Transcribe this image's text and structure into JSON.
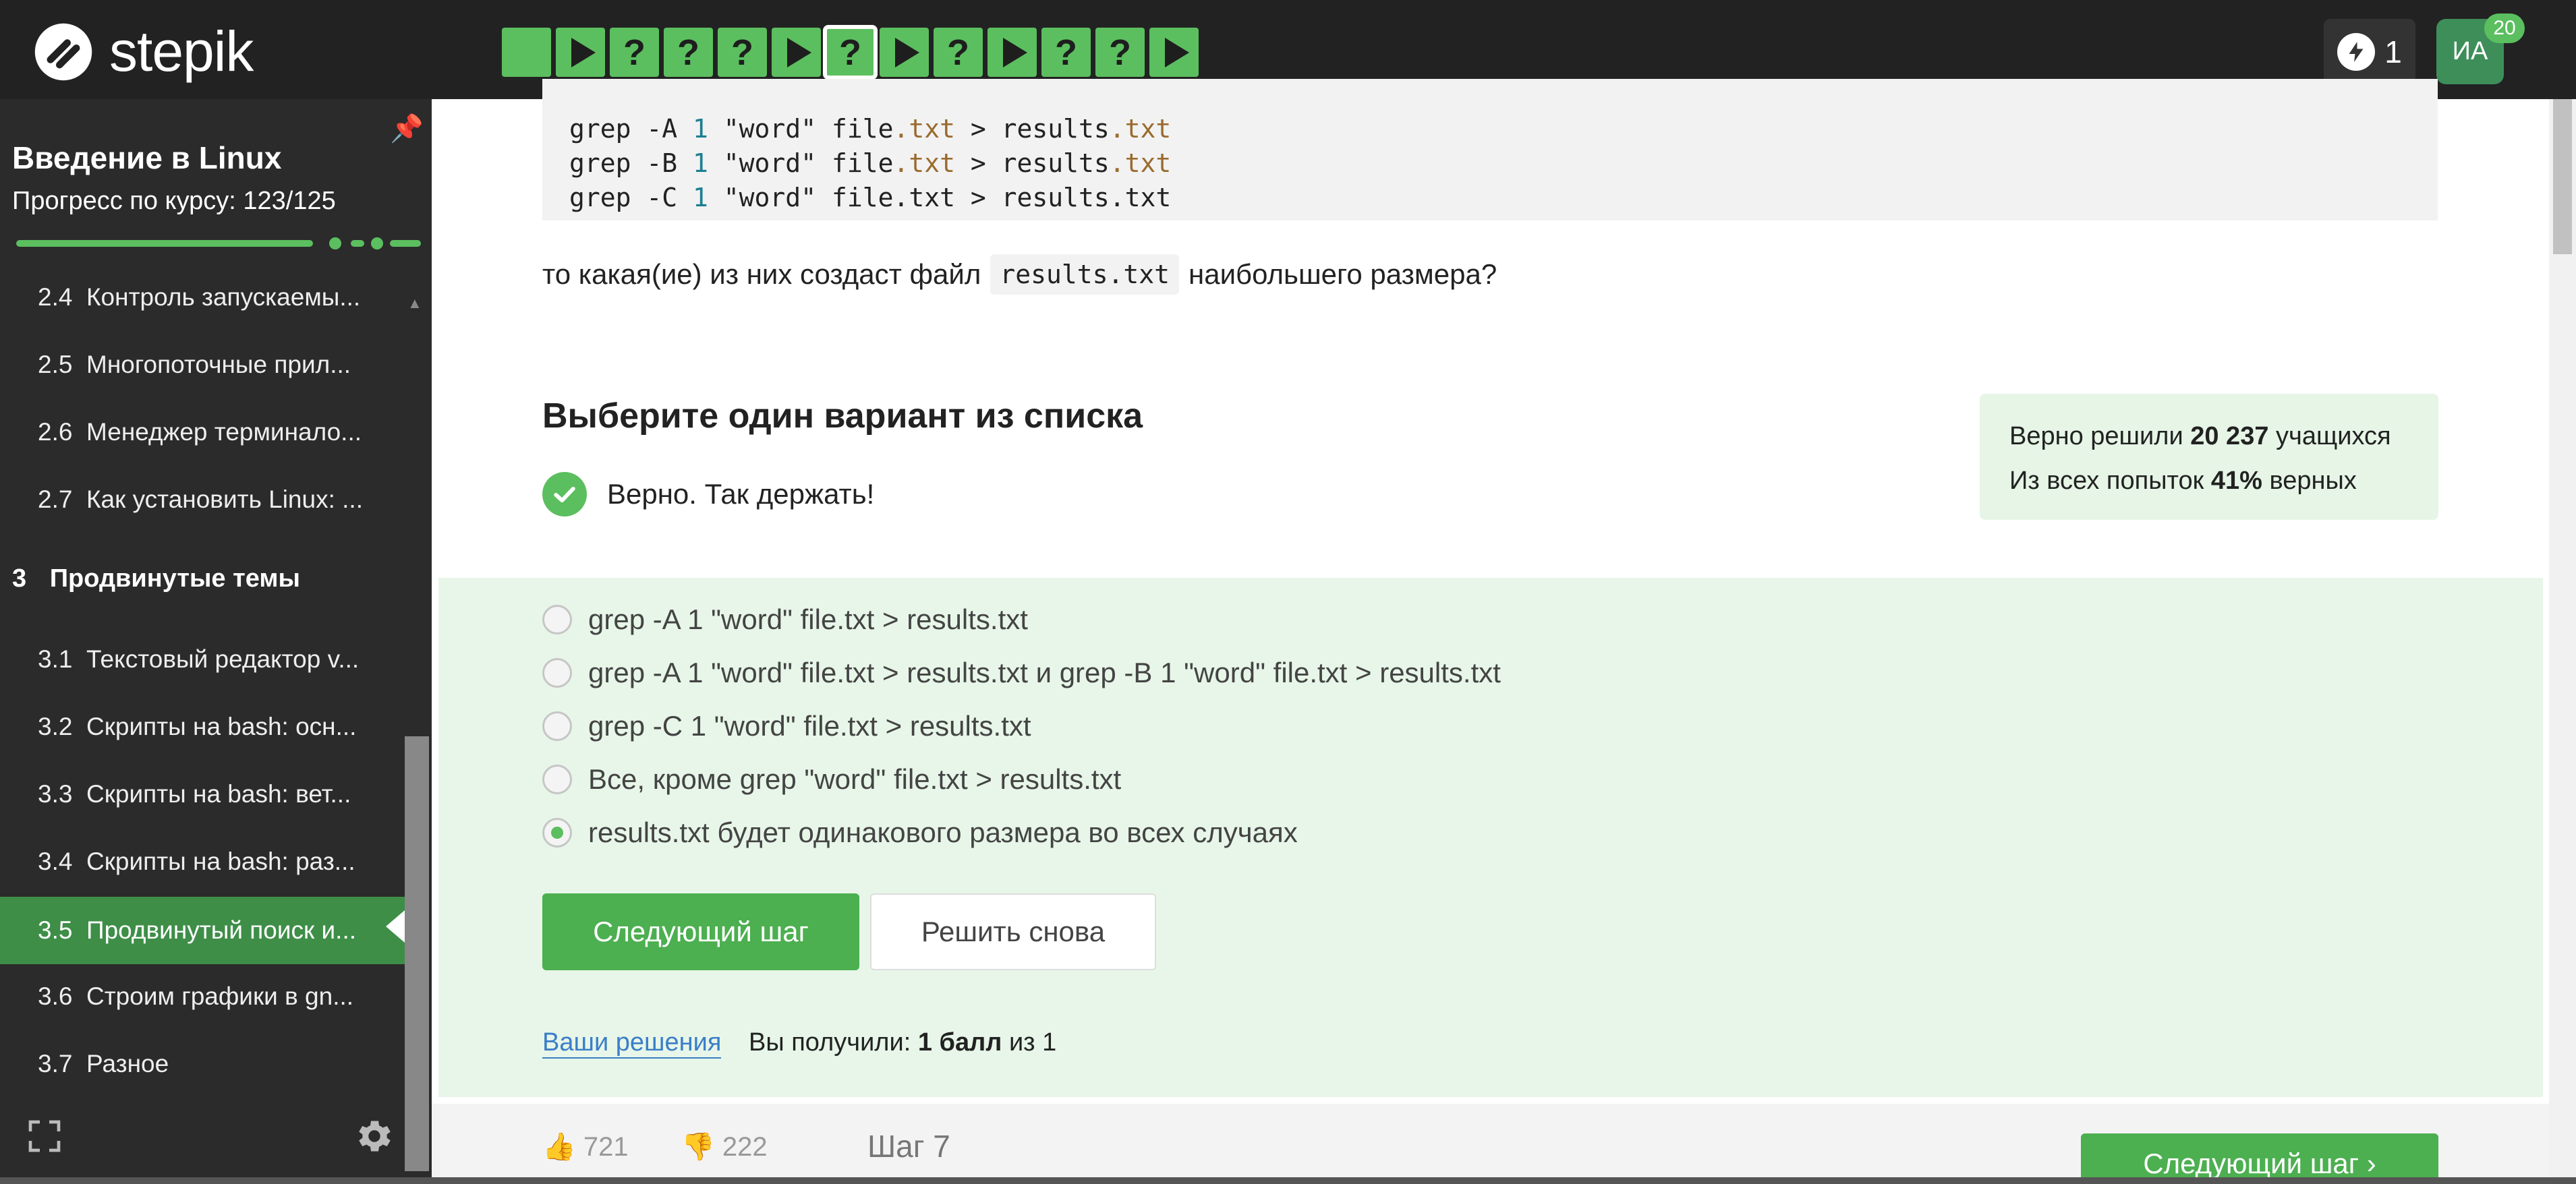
{
  "header": {
    "logo_text": "stepik",
    "steps": [
      {
        "type": "text",
        "label": ""
      },
      {
        "type": "video",
        "label": ""
      },
      {
        "type": "quiz",
        "label": "?"
      },
      {
        "type": "quiz",
        "label": "?"
      },
      {
        "type": "quiz",
        "label": "?"
      },
      {
        "type": "video",
        "label": ""
      },
      {
        "type": "quiz",
        "label": "?",
        "current": true
      },
      {
        "type": "video",
        "label": ""
      },
      {
        "type": "quiz",
        "label": "?"
      },
      {
        "type": "video",
        "label": ""
      },
      {
        "type": "quiz",
        "label": "?"
      },
      {
        "type": "quiz",
        "label": "?"
      },
      {
        "type": "video",
        "label": ""
      }
    ],
    "energy_count": "1",
    "avatar_initials": "ИА",
    "avatar_badge": "20"
  },
  "sidebar": {
    "course_title": "Введение в Linux",
    "progress_text": "Прогресс по курсу:  123/125",
    "lessons_module2": [
      {
        "num": "2.4",
        "title": "Контроль запускаемы..."
      },
      {
        "num": "2.5",
        "title": "Многопоточные прил..."
      },
      {
        "num": "2.6",
        "title": "Менеджер терминало..."
      },
      {
        "num": "2.7",
        "title": "Как установить Linux: ..."
      }
    ],
    "module3": {
      "num": "3",
      "title": "Продвинутые темы"
    },
    "lessons_module3": [
      {
        "num": "3.1",
        "title": "Текстовый редактор v..."
      },
      {
        "num": "3.2",
        "title": "Скрипты на bash: осн..."
      },
      {
        "num": "3.3",
        "title": "Скрипты на bash: вет..."
      },
      {
        "num": "3.4",
        "title": "Скрипты на bash: раз..."
      },
      {
        "num": "3.5",
        "title": "Продвинутый поиск и..."
      },
      {
        "num": "3.6",
        "title": "Строим графики в gn..."
      },
      {
        "num": "3.7",
        "title": "Разное"
      }
    ]
  },
  "main": {
    "code_lines": [
      {
        "cmd": "grep -A ",
        "num": "1",
        "rest1": " \"word\" file",
        "ext1": ".txt",
        "rest2": " > results",
        "ext2": ".txt"
      },
      {
        "cmd": "grep -B ",
        "num": "1",
        "rest1": " \"word\" file",
        "ext1": ".txt",
        "rest2": " > results",
        "ext2": ".txt"
      },
      {
        "cmd": "grep -C ",
        "num": "1",
        "rest1": " \"word\" file",
        "ext1": ".txt",
        "rest2": " > results",
        "ext2": ".txt"
      }
    ],
    "question_prefix": "то какая(ие) из них создаст файл",
    "question_code": "results.txt",
    "question_suffix": "наибольшего размера?",
    "choose_title": "Выберите один вариант из списка",
    "correct_text": "Верно. Так держать!",
    "stats_line1_prefix": "Верно решили",
    "stats_line1_value": "20 237",
    "stats_line1_suffix": "учащихся",
    "stats_line2_prefix": "Из всех попыток",
    "stats_line2_value": "41%",
    "stats_line2_suffix": "верных",
    "options": [
      "grep -A 1 \"word\" file.txt > results.txt",
      "grep -A 1 \"word\" file.txt > results.txt и grep -B 1 \"word\" file.txt > results.txt",
      "grep -C 1 \"word\" file.txt > results.txt",
      "Все, кроме grep \"word\" file.txt > results.txt",
      "results.txt будет одинакового размера во всех случаях"
    ],
    "selected_option": 4,
    "next_step_label": "Следующий шаг",
    "retry_label": "Решить снова",
    "solutions_link": "Ваши решения",
    "score_prefix": "Вы получили:",
    "score_value": "1 балл",
    "score_suffix": "из 1",
    "likes": "721",
    "dislikes": "222",
    "step_label": "Шаг 7",
    "next_step_bottom_label": "Следующий шаг"
  },
  "colors": {
    "accent": "#5bbf5f",
    "topbar": "#222222",
    "sidebar": "#2b2b2b",
    "answer_bg": "#e7f6e8",
    "link": "#3a7ec8"
  }
}
